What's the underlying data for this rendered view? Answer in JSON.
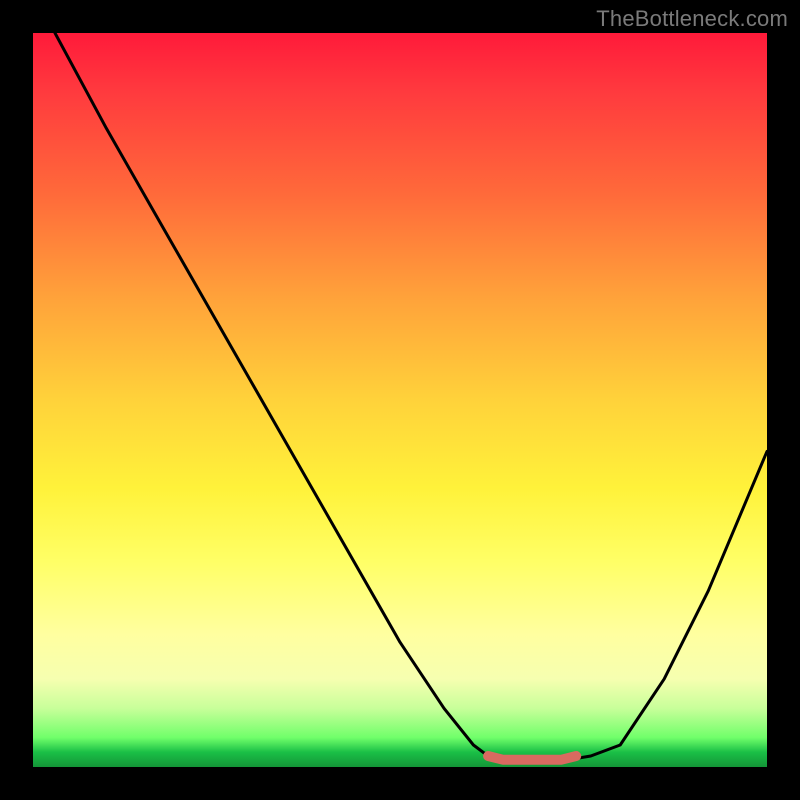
{
  "watermark": "TheBottleneck.com",
  "chart_data": {
    "type": "line",
    "title": "",
    "xlabel": "",
    "ylabel": "",
    "xlim": [
      0,
      100
    ],
    "ylim": [
      0,
      100
    ],
    "grid": false,
    "series": [
      {
        "name": "curve",
        "color": "#000000",
        "x": [
          3,
          10,
          18,
          26,
          34,
          42,
          50,
          56,
          60,
          62,
          64,
          67,
          70,
          73,
          76,
          80,
          86,
          92,
          100
        ],
        "y": [
          100,
          87,
          73,
          59,
          45,
          31,
          17,
          8,
          3,
          1.5,
          1,
          1,
          1,
          1,
          1.5,
          3,
          12,
          24,
          43
        ]
      },
      {
        "name": "trough-marker",
        "color": "#d86a60",
        "x": [
          62,
          64,
          66,
          68,
          70,
          72,
          74
        ],
        "y": [
          1.5,
          1,
          1,
          1,
          1,
          1,
          1.5
        ]
      }
    ],
    "background_gradient": {
      "top": "#ff1a3a",
      "mid_upper": "#ffa23a",
      "mid": "#fff23a",
      "mid_lower": "#ffffa0",
      "bottom": "#149538"
    }
  }
}
